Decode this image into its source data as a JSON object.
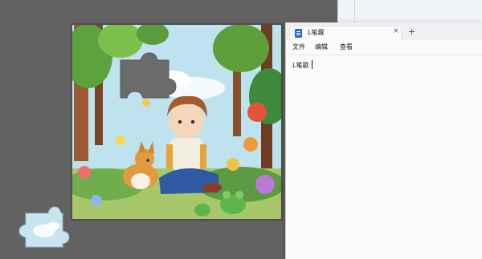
{
  "notepad": {
    "tab_title": "L笔藏",
    "tab_close": "×",
    "new_tab": "+",
    "menu": [
      "文件",
      "编辑",
      "查看"
    ],
    "text": "L笔歌"
  },
  "puzzle": {
    "board_color": "#5a5a5a",
    "sky_color": "#bfe3ee"
  },
  "icons": {
    "app": "notepad-icon",
    "close": "close-icon",
    "new_tab": "plus-icon"
  }
}
